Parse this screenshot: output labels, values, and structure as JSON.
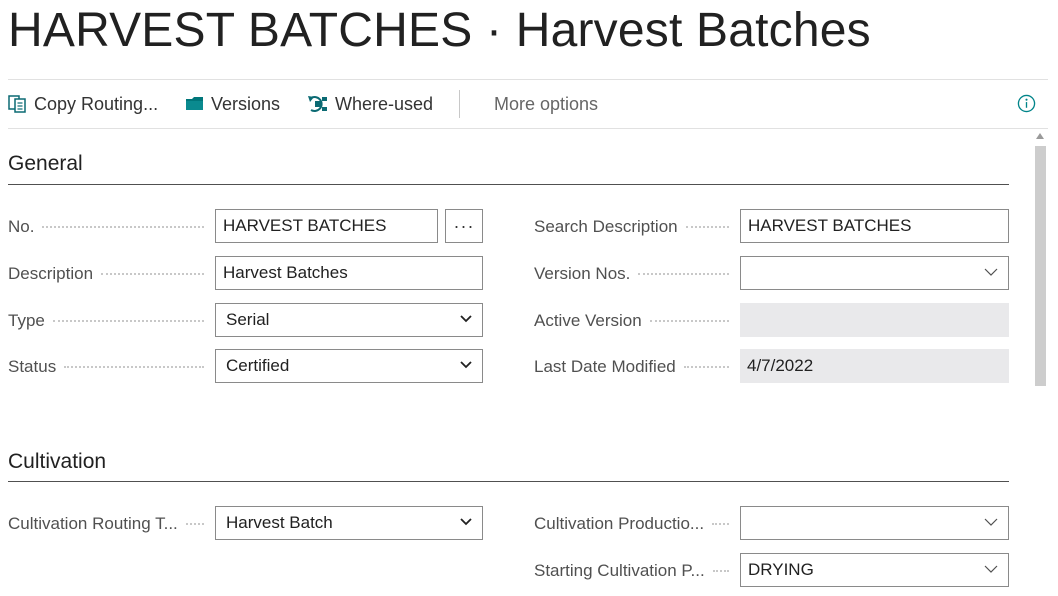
{
  "page": {
    "title": "HARVEST BATCHES · Harvest Batches"
  },
  "toolbar": {
    "copy_routing": "Copy Routing...",
    "versions": "Versions",
    "where_used": "Where-used",
    "more_options": "More options",
    "icons": {
      "copy_routing": "copy-icon",
      "versions": "folder-icon",
      "where_used": "where-used-icon",
      "info": "info-icon"
    }
  },
  "general": {
    "heading": "General",
    "no": {
      "label": "No.",
      "value": "HARVEST BATCHES",
      "assist": "···"
    },
    "description": {
      "label": "Description",
      "value": "Harvest Batches"
    },
    "type": {
      "label": "Type",
      "value": "Serial"
    },
    "status": {
      "label": "Status",
      "value": "Certified"
    },
    "search_description": {
      "label": "Search Description",
      "value": "HARVEST BATCHES"
    },
    "version_nos": {
      "label": "Version Nos.",
      "value": ""
    },
    "active_version": {
      "label": "Active Version",
      "value": ""
    },
    "last_date_modified": {
      "label": "Last Date Modified",
      "value": "4/7/2022"
    }
  },
  "cultivation": {
    "heading": "Cultivation",
    "routing_type": {
      "label": "Cultivation Routing T...",
      "value": "Harvest Batch"
    },
    "production": {
      "label": "Cultivation Productio...",
      "value": ""
    },
    "starting_process": {
      "label": "Starting Cultivation P...",
      "value": "DRYING"
    }
  },
  "colors": {
    "accent": "#008489",
    "folder": "#00767a",
    "text": "#212121",
    "label": "#505050"
  }
}
